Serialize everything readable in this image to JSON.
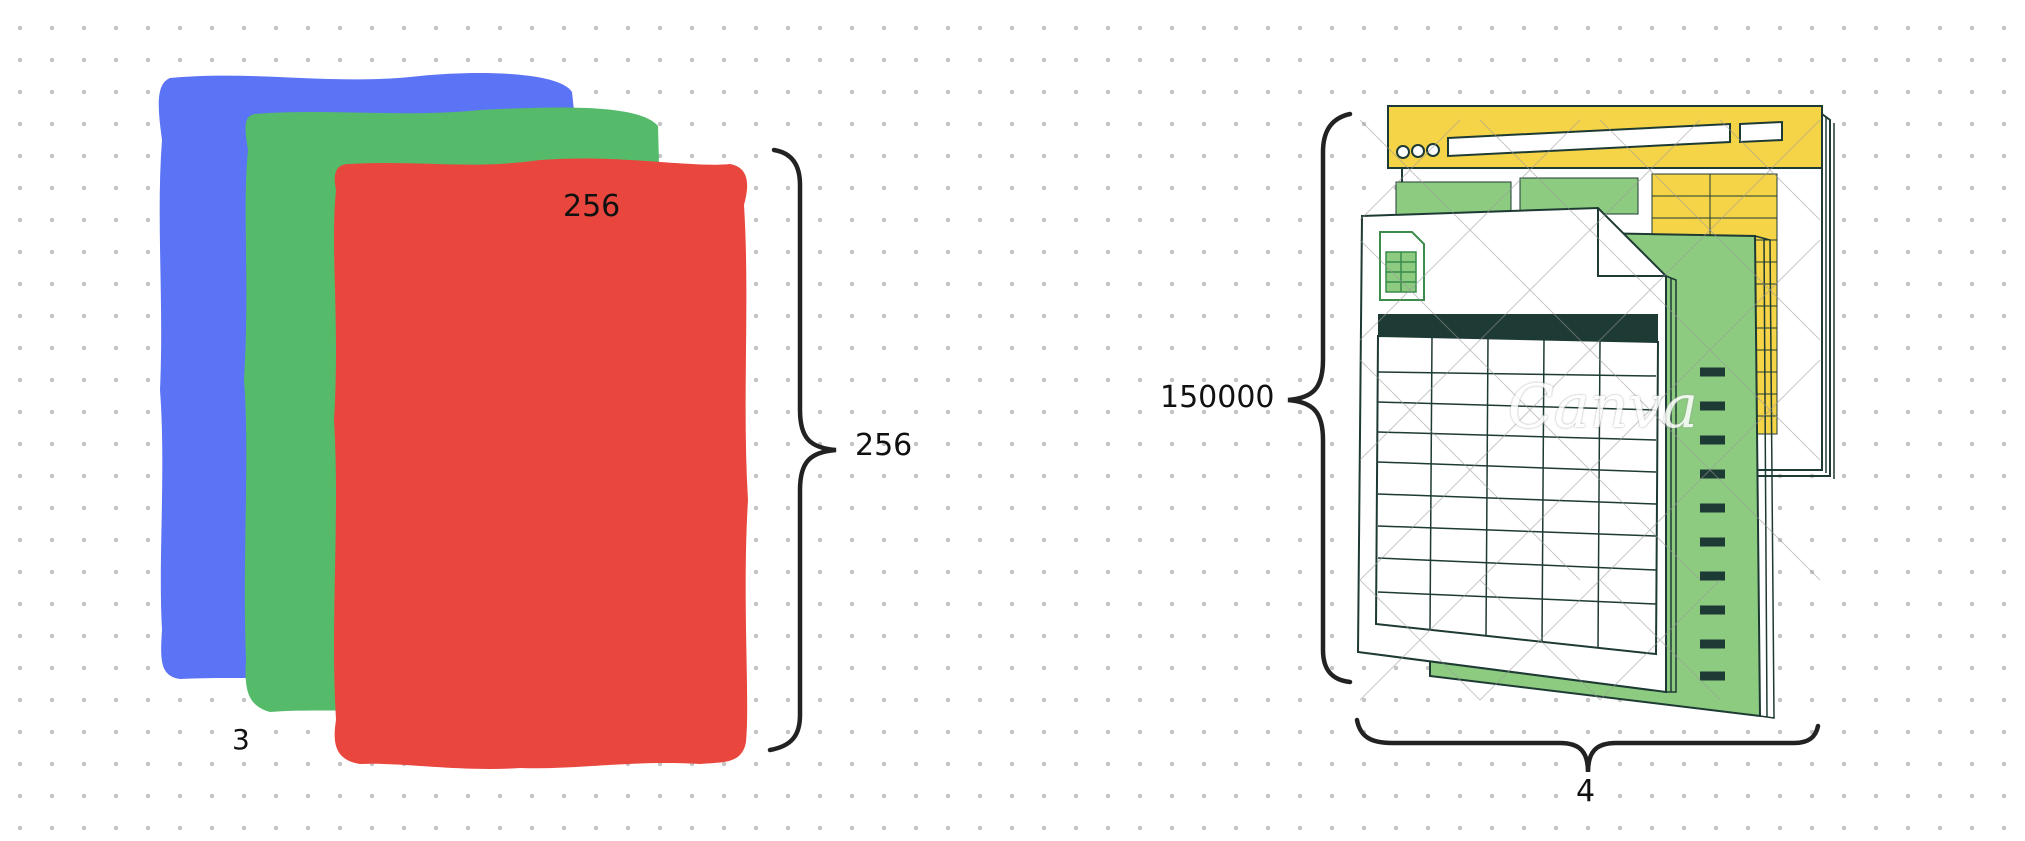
{
  "left_diagram": {
    "height_label": "256",
    "width_label": "256",
    "channels_label": "3",
    "layer_colors": {
      "blue": "#5b73f5",
      "green": "#55bb6a",
      "red": "#e9473e"
    }
  },
  "right_diagram": {
    "rows_label": "150000",
    "columns_label": "4",
    "watermark": "Canva",
    "colors": {
      "header_yellow": "#f5d547",
      "sheet_green": "#8ccb80",
      "ink": "#1e3a34"
    }
  }
}
